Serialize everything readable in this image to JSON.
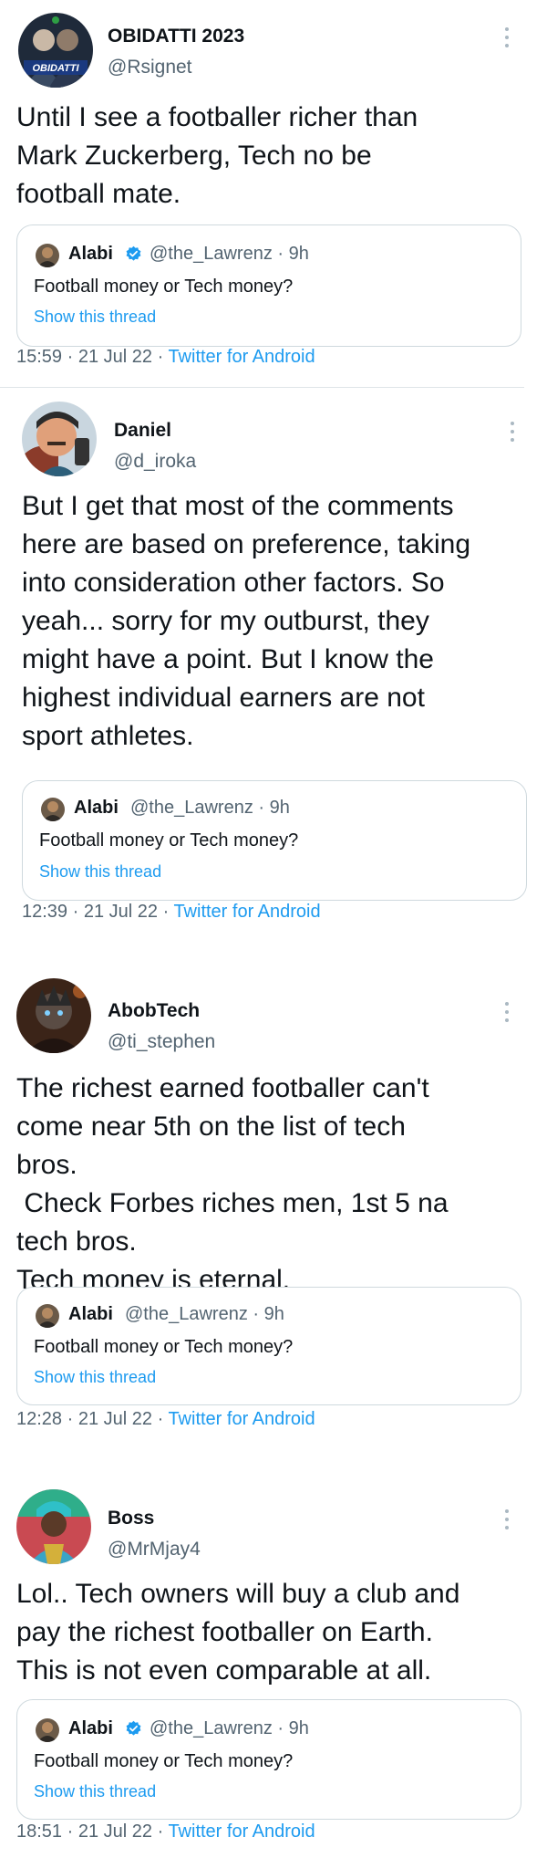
{
  "colors": {
    "accent": "#1d9bf0",
    "secondary_text": "#536471",
    "border": "#cfd9de"
  },
  "quoted": {
    "name": "Alabi",
    "handle_time": "@the_Lawrenz · 9h",
    "text": "Football money or Tech money?",
    "show_thread": "Show this thread"
  },
  "tweets": [
    {
      "name": "OBIDATTI 2023",
      "handle": "@Rsignet",
      "text": "Until I see a footballer richer than\nMark Zuckerberg, Tech no be\nfootball mate.",
      "time": "15:59",
      "date": "21 Jul 22",
      "source": "Twitter for Android",
      "avatar_text": "OBIDATTI",
      "quote_verified": true
    },
    {
      "name": "Daniel",
      "handle": "@d_iroka",
      "text": "But I get that most of the comments\nhere are based on preference, taking\ninto consideration other factors. So\nyeah... sorry for my outburst, they\nmight have a point. But I know the\nhighest individual earners are not\nsport athletes.",
      "time": "12:39",
      "date": "21 Jul 22",
      "source": "Twitter for Android",
      "quote_verified": false
    },
    {
      "name": "AbobTech",
      "handle": "@ti_stephen",
      "text": "The richest earned footballer can't\ncome near 5th on the list of tech\nbros.\n Check Forbes riches men, 1st 5 na\ntech bros.\nTech money is eternal.",
      "time": "12:28",
      "date": "21 Jul 22",
      "source": "Twitter for Android",
      "quote_verified": false
    },
    {
      "name": "Boss",
      "handle": "@MrMjay4",
      "text": "Lol.. Tech owners will buy a club and\npay the richest footballer on Earth.\nThis is not even comparable at all.",
      "time": "18:51",
      "date": "21 Jul 22",
      "source": "Twitter for Android",
      "quote_verified": true
    }
  ],
  "separator": " · "
}
